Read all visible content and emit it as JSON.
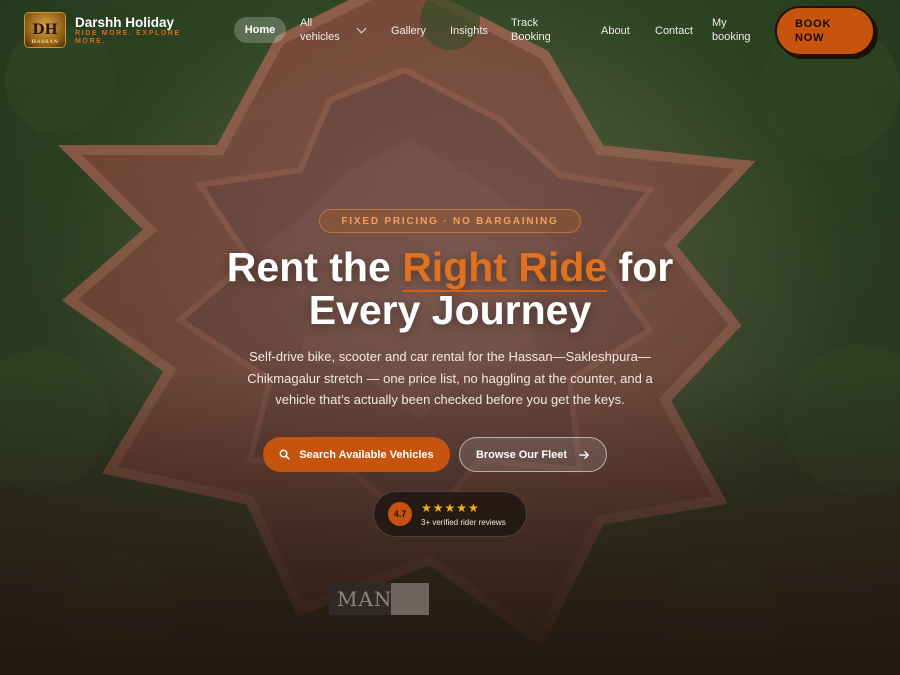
{
  "brand": {
    "logo_text": "DH",
    "logo_subtext": "HASSAN",
    "name": "Darshh Holiday",
    "tagline": "RIDE MORE. EXPLORE MORE."
  },
  "nav": {
    "items": [
      {
        "label": "Home",
        "active": true
      },
      {
        "label": "All vehicles",
        "has_dropdown": true
      },
      {
        "label": "Gallery"
      },
      {
        "label": "Insights"
      },
      {
        "label": "Track Booking"
      },
      {
        "label": "About"
      },
      {
        "label": "Contact"
      },
      {
        "label": "My booking"
      }
    ],
    "cta": "BOOK NOW"
  },
  "hero": {
    "pill": "FIXED PRICING · NO BARGAINING",
    "headline_before": "Rent the ",
    "headline_accent": "Right Ride",
    "headline_after": " for",
    "headline_line2": "Every Journey",
    "subtitle": "Self-drive bike, scooter and car rental for the Hassan—Sakleshpura—Chikmagalur stretch — one price list, no haggling at the counter, and a vehicle that’s actually been checked before you get the keys.",
    "primary_cta": "Search Available Vehicles",
    "secondary_cta": "Browse Our Fleet"
  },
  "rating": {
    "score": "4.7",
    "stars": "★★★★★",
    "caption": "3+ verified rider reviews"
  },
  "overlay_text": "MAN",
  "colors": {
    "accent": "#c7540e",
    "accent_text": "#e0711f",
    "star": "#f3b11c"
  },
  "icons": {
    "search": "search-icon",
    "arrow": "arrow-right-icon",
    "dropdown": "chevron-down-icon"
  }
}
